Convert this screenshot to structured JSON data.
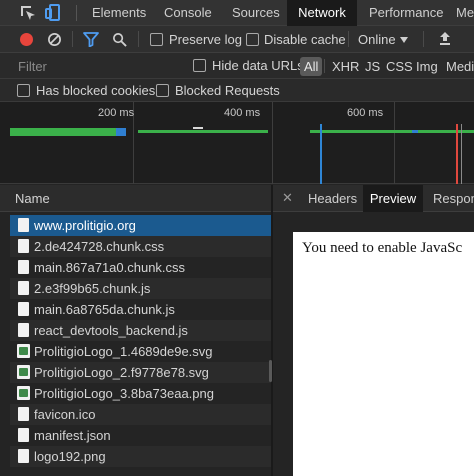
{
  "tabs": [
    {
      "label": "Elements"
    },
    {
      "label": "Console"
    },
    {
      "label": "Sources"
    },
    {
      "label": "Network"
    },
    {
      "label": "Performance"
    },
    {
      "label": "Me"
    }
  ],
  "active_tab": "Network",
  "toolbar": {
    "preserve_log": {
      "label": "Preserve log",
      "checked": false
    },
    "disable_cache": {
      "label": "Disable cache",
      "checked": false
    },
    "throttle": "Online"
  },
  "filter": {
    "placeholder": "Filter",
    "hide_data_urls": {
      "label": "Hide data URLs",
      "checked": false
    },
    "types": [
      "All",
      "XHR",
      "JS",
      "CSS",
      "Img",
      "Medi"
    ],
    "selected_type": "All"
  },
  "blocked": {
    "has_blocked_cookies": {
      "label": "Has blocked cookies",
      "checked": false
    },
    "blocked_requests": {
      "label": "Blocked Requests",
      "checked": false
    }
  },
  "overview": {
    "ticks": [
      "200 ms",
      "400 ms",
      "600 ms"
    ]
  },
  "requests": {
    "header": "Name",
    "rows": [
      {
        "name": "www.prolitigio.org",
        "icon": "document-icon",
        "selected": true
      },
      {
        "name": "2.de424728.chunk.css",
        "icon": "file-icon"
      },
      {
        "name": "main.867a71a0.chunk.css",
        "icon": "file-icon"
      },
      {
        "name": "2.e3f99b65.chunk.js",
        "icon": "file-icon"
      },
      {
        "name": "main.6a8765da.chunk.js",
        "icon": "file-icon"
      },
      {
        "name": "react_devtools_backend.js",
        "icon": "file-icon"
      },
      {
        "name": "ProlitigioLogo_1.4689de9e.svg",
        "icon": "image-icon"
      },
      {
        "name": "ProlitigioLogo_2.f9778e78.svg",
        "icon": "image-icon"
      },
      {
        "name": "ProlitigioLogo_3.8ba73eaa.png",
        "icon": "image-icon"
      },
      {
        "name": "favicon.ico",
        "icon": "file-icon"
      },
      {
        "name": "manifest.json",
        "icon": "file-icon"
      },
      {
        "name": "logo192.png",
        "icon": "file-icon"
      }
    ]
  },
  "details": {
    "tabs": [
      "Headers",
      "Preview",
      "Respon"
    ],
    "active": "Preview",
    "preview_text": "You need to enable JavaSc"
  },
  "colors": {
    "record": "#e8453c",
    "selected_row": "#1b5a8f",
    "bar_green": "#3bb14a",
    "bar_blue": "#2f7fd1",
    "dom_line": "#2f86d6",
    "load_line": "#e0483e"
  }
}
